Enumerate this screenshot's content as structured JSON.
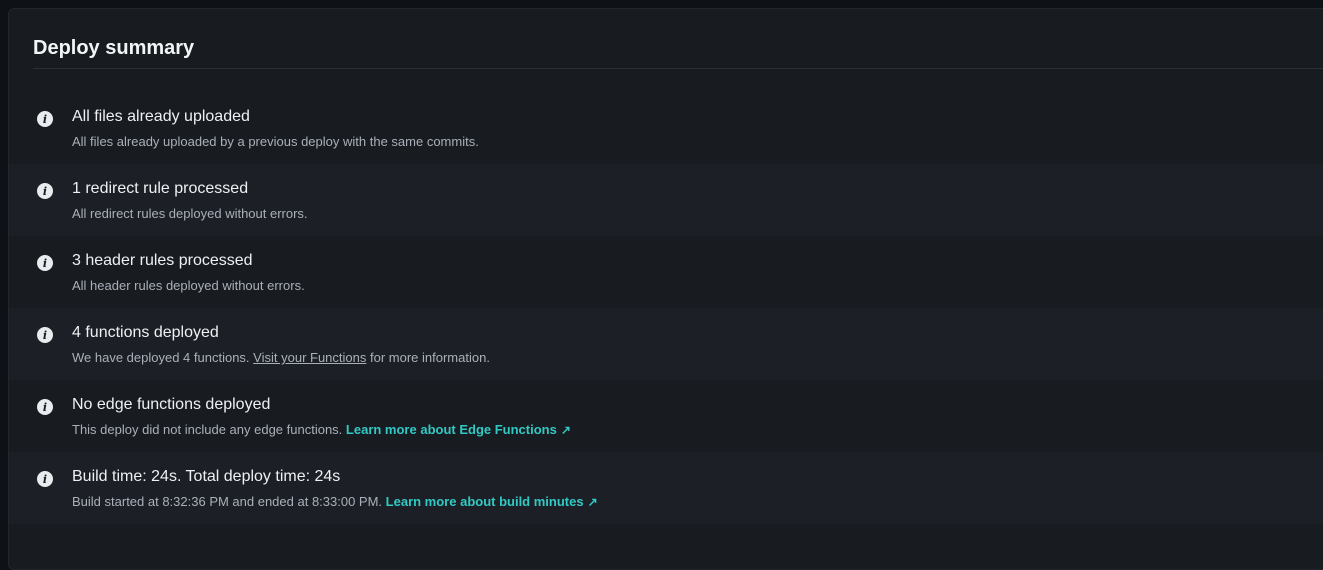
{
  "panel": {
    "title": "Deploy summary"
  },
  "items": [
    {
      "title": "All files already uploaded",
      "desc": "All files already uploaded by a previous deploy with the same commits."
    },
    {
      "title": "1 redirect rule processed",
      "desc": "All redirect rules deployed without errors."
    },
    {
      "title": "3 header rules processed",
      "desc": "All header rules deployed without errors."
    },
    {
      "title": "4 functions deployed",
      "desc_pre": "We have deployed 4 functions.",
      "link": "Visit your Functions",
      "desc_post": "for more information."
    },
    {
      "title": "No edge functions deployed",
      "desc": "This deploy did not include any edge functions.",
      "link": "Learn more about Edge Functions",
      "link_icon": "↗"
    },
    {
      "title": "Build time: 24s. Total deploy time: 24s",
      "desc": "Build started at 8:32:36 PM and ended at 8:33:00 PM.",
      "link": "Learn more about build minutes",
      "link_icon": "↗"
    }
  ],
  "icons": {
    "info_glyph": "i"
  },
  "colors": {
    "link_accent": "#32c9c4",
    "card_background": "#181b20",
    "row_alt_background": "#1c2026"
  }
}
